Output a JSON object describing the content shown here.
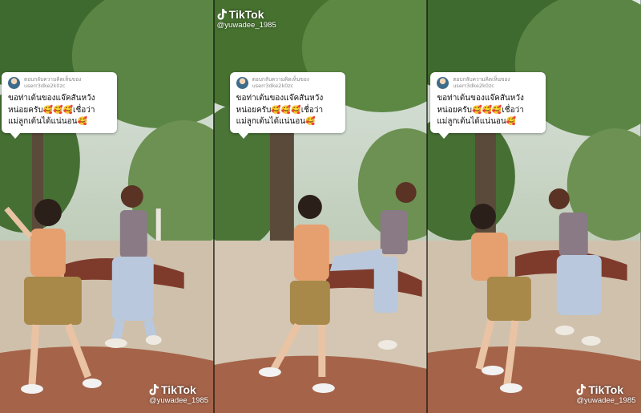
{
  "comment": {
    "reply_label": "ตอบกลับความคิดเห็นของ",
    "username": "userr3dke2k0zc",
    "text": "ขอท่าเต้นของแจ๊คสันหวัง\nหน่อยครับ🥰🥰🥰เชื่อว่า\nแม่ลูกเต้นได้แน่นอน🥰"
  },
  "watermark": {
    "brand": "TikTok",
    "handle": "@yuwadee_1985"
  },
  "colors": {
    "foliage": "#4f7a3c",
    "ground": "#c9b9a6",
    "dirt_red": "#9a5a3a",
    "bubble": "#ffffff"
  },
  "icons": {
    "tiktok": "tiktok-note-icon",
    "avatar": "avatar"
  }
}
